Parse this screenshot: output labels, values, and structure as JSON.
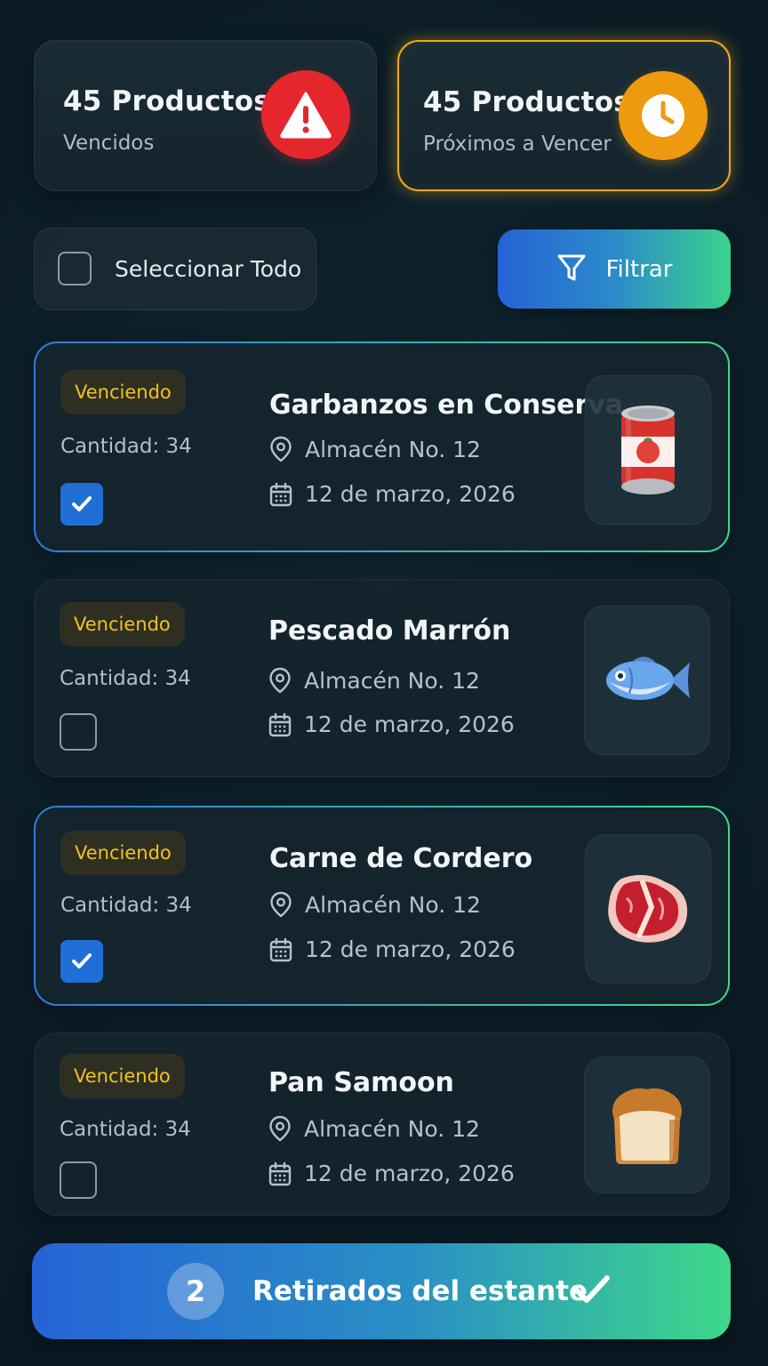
{
  "summary": {
    "expired": {
      "title": "45 Productos",
      "subtitle": "Vencidos",
      "icon": "warning-icon",
      "color": "#e5272d"
    },
    "expiring": {
      "title": "45 Productos",
      "subtitle": "Próximos a Vencer",
      "icon": "clock-icon",
      "color": "#ee9a0f"
    }
  },
  "controls": {
    "select_all_label": "Seleccionar Todo",
    "select_all_checked": false,
    "filter_label": "Filtrar",
    "filter_icon": "filter-icon"
  },
  "products": [
    {
      "badge": "Venciendo",
      "quantity": "Cantidad: 34",
      "name": "Garbanzos en Conserva",
      "location": "Almacén No. 12",
      "date": "12 de marzo, 2026",
      "checked": true,
      "image": "canned-food-icon"
    },
    {
      "badge": "Venciendo",
      "quantity": "Cantidad: 34",
      "name": "Pescado Marrón",
      "location": "Almacén No. 12",
      "date": "12 de marzo, 2026",
      "checked": false,
      "image": "fish-icon"
    },
    {
      "badge": "Venciendo",
      "quantity": "Cantidad: 34",
      "name": "Carne de Cordero",
      "location": "Almacén No. 12",
      "date": "12 de marzo, 2026",
      "checked": true,
      "image": "meat-icon"
    },
    {
      "badge": "Venciendo",
      "quantity": "Cantidad: 34",
      "name": "Pan Samoon",
      "location": "Almacén No. 12",
      "date": "12 de marzo, 2026",
      "checked": false,
      "image": "bread-icon"
    }
  ],
  "action": {
    "count": "2",
    "label": "Retirados del estante",
    "icon": "checkmark-icon"
  },
  "colors": {
    "accent_blue": "#2563d6",
    "accent_green": "#3ed88a",
    "badge_text": "#f1c21b",
    "background": "#0b1c25"
  }
}
